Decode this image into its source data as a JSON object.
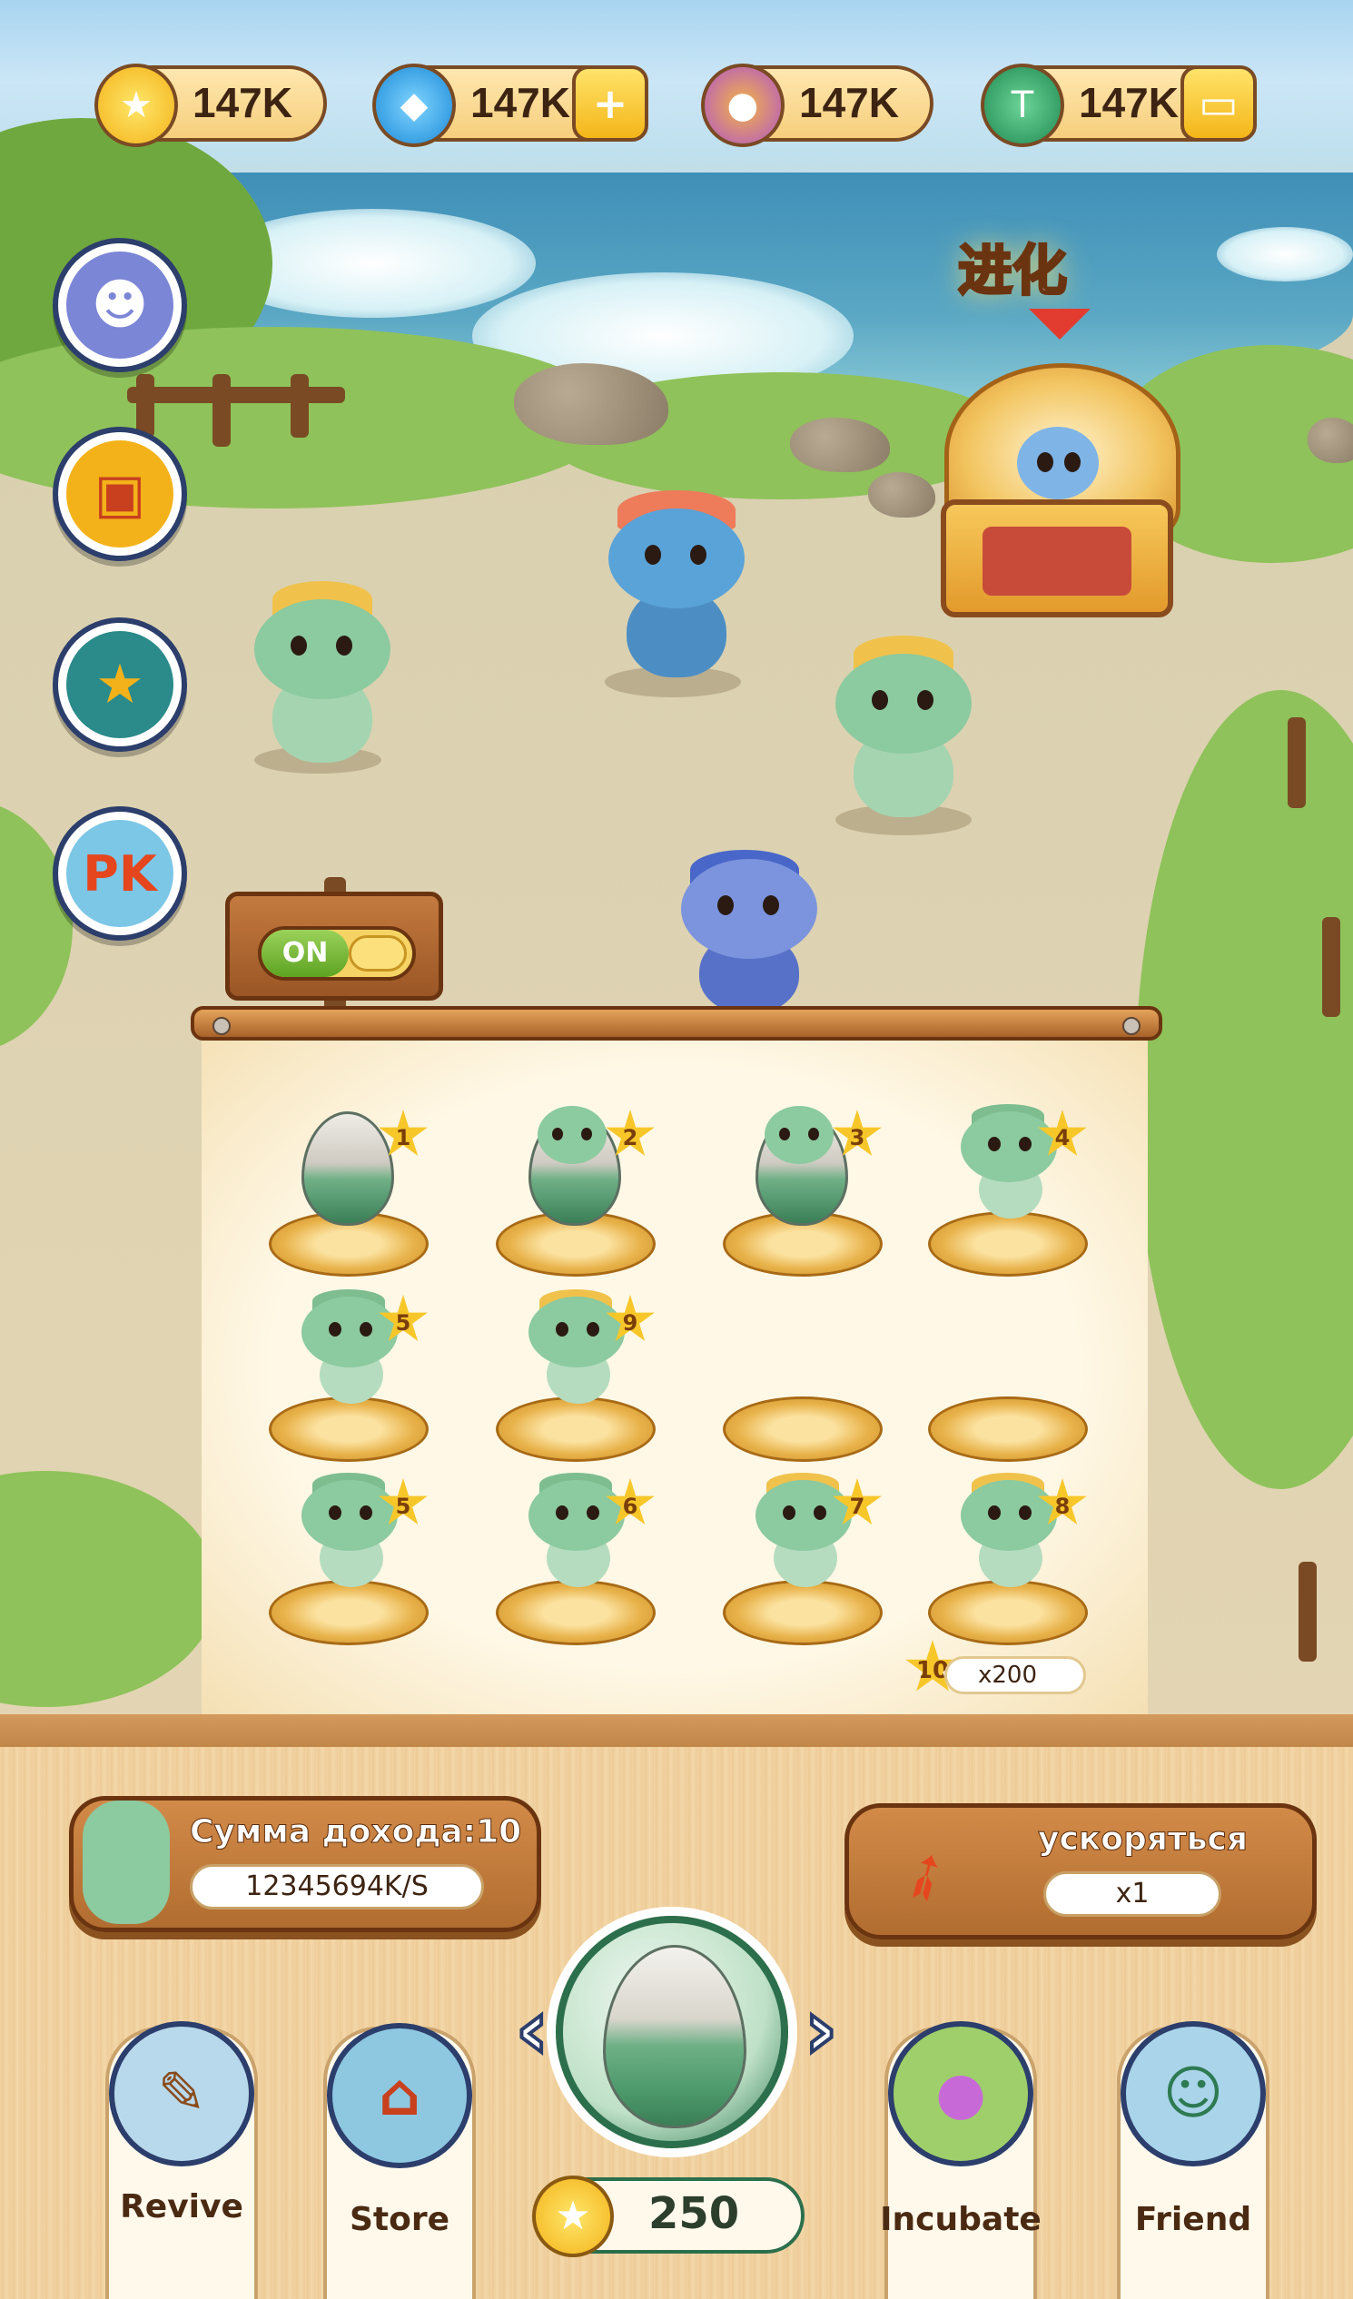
{
  "resources": [
    {
      "icon": "gold-coin-icon",
      "value": "147K",
      "color": "#f6c12a",
      "glyph": "★",
      "has_add": false
    },
    {
      "icon": "gem-icon",
      "value": "147K",
      "color": "#27a2e6",
      "glyph": "◆",
      "has_add": true,
      "add_glyph": "+"
    },
    {
      "icon": "dragon-coin-icon",
      "value": "147K",
      "color": "#c76ad8",
      "glyph": "●",
      "has_add": false
    },
    {
      "icon": "tether-icon",
      "value": "147K",
      "color": "#2ea36b",
      "glyph": "T",
      "has_add": true,
      "add_glyph": "▭"
    }
  ],
  "side_buttons": [
    {
      "name": "dragon-avatar-button",
      "icon": "dragon-face-icon",
      "glyph": "☻",
      "color": "#7b86d6"
    },
    {
      "name": "book-button",
      "icon": "book-icon",
      "glyph": "▣",
      "color": "#f3b21a"
    },
    {
      "name": "badge-button",
      "icon": "star-badge-icon",
      "glyph": "★",
      "color": "#2b8a8a"
    },
    {
      "name": "pk-button",
      "icon": "pk-icon",
      "glyph": "PK",
      "color": "#e5461e"
    }
  ],
  "evolve": {
    "label": "进化"
  },
  "auto_toggle": {
    "label": "ON"
  },
  "grid": [
    {
      "stage": "egg",
      "level": "1"
    },
    {
      "stage": "hatching",
      "level": "2"
    },
    {
      "stage": "hatching",
      "level": "3"
    },
    {
      "stage": "baby",
      "level": "4"
    },
    {
      "stage": "baby",
      "level": "5"
    },
    {
      "stage": "adult",
      "level": "9"
    },
    {
      "stage": "empty",
      "level": ""
    },
    {
      "stage": "empty",
      "level": ""
    },
    {
      "stage": "baby",
      "level": "5"
    },
    {
      "stage": "baby",
      "level": "6"
    },
    {
      "stage": "adult",
      "level": "7"
    },
    {
      "stage": "adult",
      "level": "8"
    }
  ],
  "counter": {
    "level": "10",
    "value": "x200"
  },
  "income": {
    "title": "Сумма дохода:10",
    "rate": "12345694K/S"
  },
  "speed": {
    "title": "ускоряться",
    "multiplier": "x1"
  },
  "nav": [
    {
      "name": "revive",
      "label": "Revive",
      "icon": "scroll-quill-icon",
      "glyph": "✎",
      "color": "#b8d9ec"
    },
    {
      "name": "store",
      "label": "Store",
      "icon": "shop-icon",
      "glyph": "⌂",
      "color": "#8ec7e0"
    },
    {
      "name": "incubate",
      "label": "Incubate",
      "icon": "nest-eggs-icon",
      "glyph": "●",
      "color": "#9ecf6a"
    },
    {
      "name": "friend",
      "label": "Friend",
      "icon": "friends-icon",
      "glyph": "☺",
      "color": "#a9d4ea"
    }
  ],
  "hatch": {
    "price": "250"
  }
}
